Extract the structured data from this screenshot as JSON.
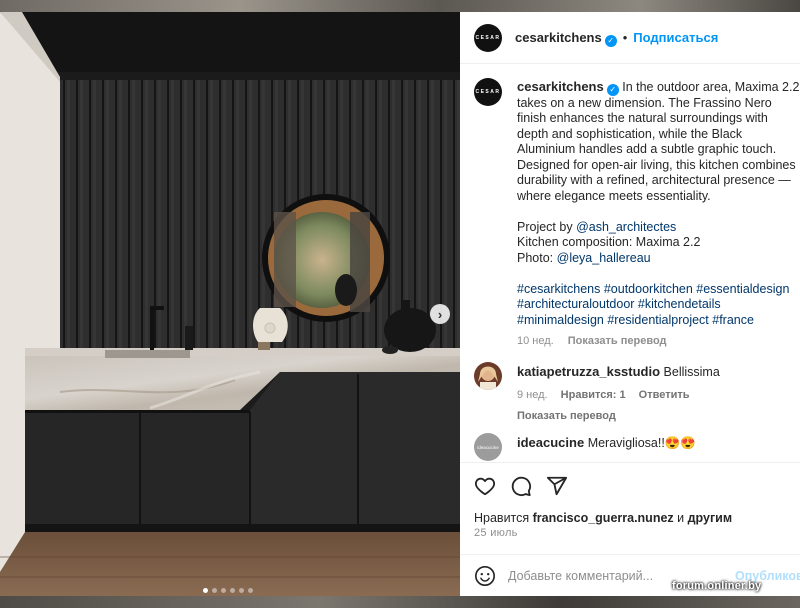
{
  "account": {
    "username": "cesarkitchens",
    "avatar_text": "CESAR",
    "follow_label": "Подписаться",
    "separator": "•"
  },
  "caption": {
    "text": "In the outdoor area, Maxima 2.2 takes on a new dimension. The Frassino Nero finish enhances the natural surroundings with depth and sophistication, while the Black Aluminium handles add a subtle graphic touch. Designed for open-air living, this kitchen combines durability with a refined, architectural presence — where elegance meets essentiality.",
    "project_label": "Project by ",
    "project_link": "@ash_architectes",
    "composition": "Kitchen composition: Maxima 2.2",
    "photo_label": "Photo: ",
    "photo_link": "@leya_hallereau",
    "hashtags": "#cesarkitchens #outdoorkitchen #essentialdesign #architecturaloutdoor #kitchendetails #minimaldesign #residentialproject #france",
    "time": "10 нед.",
    "translate": "Показать перевод"
  },
  "comments": [
    {
      "user": "katiapetruzza_ksstudio",
      "text": "Bellissima",
      "time": "9 нед.",
      "likes": "Нравится: 1",
      "reply": "Ответить",
      "translate": "Показать перевод"
    },
    {
      "user": "ideacucine",
      "text": "Meravigliosa!!😍😍",
      "avatar_text": "ideacucine"
    }
  ],
  "actions": {
    "liked_by_prefix": "Нравится ",
    "liked_by_user": "francisco_guerra.nunez",
    "liked_by_suffix": " и ",
    "liked_by_others": "другим",
    "date": "25 июль"
  },
  "add_comment": {
    "placeholder": "Добавьте комментарий...",
    "post_label": "Опубликовать"
  },
  "carousel": {
    "slides": 6,
    "active": 1,
    "next_glyph": "›"
  },
  "watermark": "forum.onliner.by",
  "icons": {
    "like": "heart-icon",
    "comment": "comment-icon",
    "share": "share-icon",
    "emoji": "emoji-icon",
    "verified": "verified-badge-icon",
    "next": "chevron-right-icon"
  }
}
